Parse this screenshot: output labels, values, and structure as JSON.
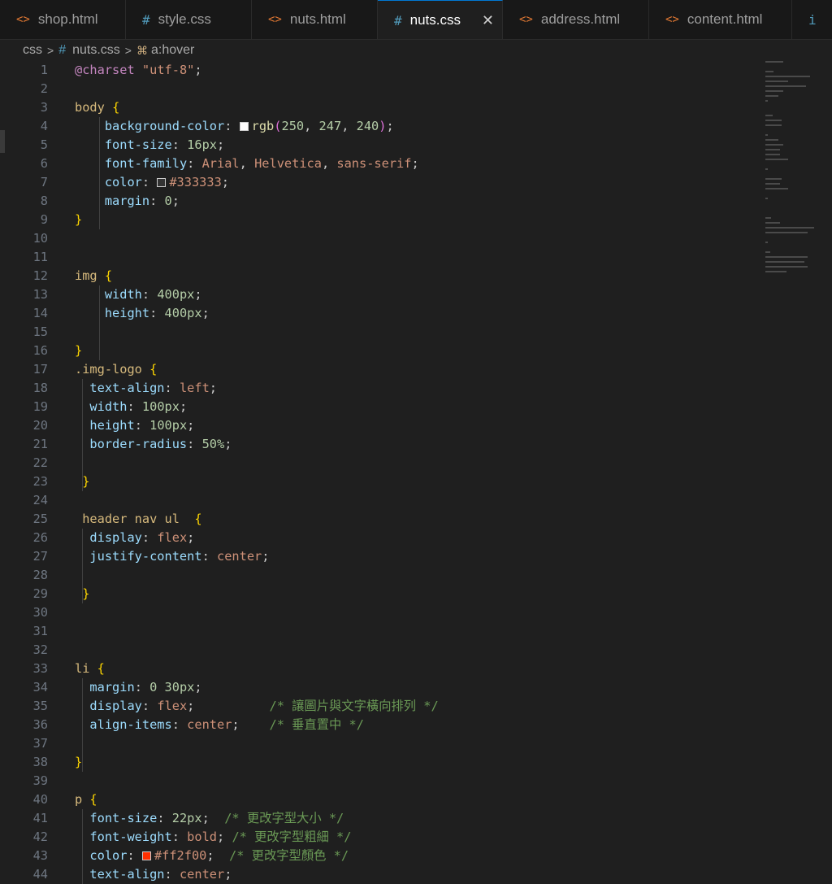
{
  "tabs": [
    {
      "label": "shop.html",
      "kind": "html",
      "icon": "html-file-icon"
    },
    {
      "label": "style.css",
      "kind": "css",
      "icon": "css-file-icon"
    },
    {
      "label": "nuts.html",
      "kind": "html",
      "icon": "html-file-icon"
    },
    {
      "label": "nuts.css",
      "kind": "css",
      "icon": "css-file-icon",
      "active": true
    },
    {
      "label": "address.html",
      "kind": "html",
      "icon": "html-file-icon"
    },
    {
      "label": "content.html",
      "kind": "html",
      "icon": "html-file-icon"
    }
  ],
  "close_glyph": "✕",
  "breadcrumb": {
    "folder": "css",
    "file": "nuts.css",
    "symbol": "a:hover"
  },
  "code_lines": [
    {
      "n": "1",
      "segs": [
        [
          "@charset",
          "at"
        ],
        [
          " ",
          ""
        ],
        [
          "\"utf-8\"",
          "str"
        ],
        [
          ";",
          "punc"
        ]
      ]
    },
    {
      "n": "2",
      "segs": []
    },
    {
      "n": "3",
      "segs": [
        [
          "body ",
          "sel"
        ],
        [
          "{",
          "brace"
        ]
      ]
    },
    {
      "n": "4",
      "segs": [
        [
          "    ",
          ""
        ],
        [
          "background-color",
          "prop"
        ],
        [
          ": ",
          "punc"
        ],
        [
          "#fffefe",
          "swatch"
        ],
        [
          "rgb",
          "fn"
        ],
        [
          "(",
          "paren"
        ],
        [
          "250",
          "num"
        ],
        [
          ", ",
          "punc"
        ],
        [
          "247",
          "num"
        ],
        [
          ", ",
          "punc"
        ],
        [
          "240",
          "num"
        ],
        [
          ")",
          "paren"
        ],
        [
          ";",
          "punc"
        ]
      ]
    },
    {
      "n": "5",
      "segs": [
        [
          "    ",
          ""
        ],
        [
          "font-size",
          "prop"
        ],
        [
          ": ",
          "punc"
        ],
        [
          "16px",
          "num"
        ],
        [
          ";",
          "punc"
        ]
      ]
    },
    {
      "n": "6",
      "segs": [
        [
          "    ",
          ""
        ],
        [
          "font-family",
          "prop"
        ],
        [
          ": ",
          "punc"
        ],
        [
          "Arial",
          "val"
        ],
        [
          ", ",
          "punc"
        ],
        [
          "Helvetica",
          "val"
        ],
        [
          ", ",
          "punc"
        ],
        [
          "sans-serif",
          "val"
        ],
        [
          ";",
          "punc"
        ]
      ]
    },
    {
      "n": "7",
      "segs": [
        [
          "    ",
          ""
        ],
        [
          "color",
          "prop"
        ],
        [
          ": ",
          "punc"
        ],
        [
          "#333333",
          "swatch"
        ],
        [
          "#333333",
          "val"
        ],
        [
          ";",
          "punc"
        ]
      ]
    },
    {
      "n": "8",
      "segs": [
        [
          "    ",
          ""
        ],
        [
          "margin",
          "prop"
        ],
        [
          ": ",
          "punc"
        ],
        [
          "0",
          "num"
        ],
        [
          ";",
          "punc"
        ]
      ]
    },
    {
      "n": "9",
      "segs": [
        [
          "}",
          "brace"
        ]
      ]
    },
    {
      "n": "10",
      "segs": []
    },
    {
      "n": "11",
      "segs": []
    },
    {
      "n": "12",
      "segs": [
        [
          "img ",
          "sel"
        ],
        [
          "{",
          "brace"
        ]
      ]
    },
    {
      "n": "13",
      "segs": [
        [
          "    ",
          ""
        ],
        [
          "width",
          "prop"
        ],
        [
          ": ",
          "punc"
        ],
        [
          "400px",
          "num"
        ],
        [
          ";",
          "punc"
        ]
      ]
    },
    {
      "n": "14",
      "segs": [
        [
          "    ",
          ""
        ],
        [
          "height",
          "prop"
        ],
        [
          ": ",
          "punc"
        ],
        [
          "400px",
          "num"
        ],
        [
          ";",
          "punc"
        ]
      ]
    },
    {
      "n": "15",
      "segs": []
    },
    {
      "n": "16",
      "segs": [
        [
          "}",
          "brace"
        ]
      ]
    },
    {
      "n": "17",
      "segs": [
        [
          ".img-logo ",
          "sel"
        ],
        [
          "{",
          "brace"
        ]
      ]
    },
    {
      "n": "18",
      "segs": [
        [
          "  ",
          ""
        ],
        [
          "text-align",
          "prop"
        ],
        [
          ": ",
          "punc"
        ],
        [
          "left",
          "val"
        ],
        [
          ";",
          "punc"
        ]
      ]
    },
    {
      "n": "19",
      "segs": [
        [
          "  ",
          ""
        ],
        [
          "width",
          "prop"
        ],
        [
          ": ",
          "punc"
        ],
        [
          "100px",
          "num"
        ],
        [
          ";",
          "punc"
        ]
      ]
    },
    {
      "n": "20",
      "segs": [
        [
          "  ",
          ""
        ],
        [
          "height",
          "prop"
        ],
        [
          ": ",
          "punc"
        ],
        [
          "100px",
          "num"
        ],
        [
          ";",
          "punc"
        ]
      ]
    },
    {
      "n": "21",
      "segs": [
        [
          "  ",
          ""
        ],
        [
          "border-radius",
          "prop"
        ],
        [
          ": ",
          "punc"
        ],
        [
          "50%",
          "num"
        ],
        [
          ";",
          "punc"
        ]
      ]
    },
    {
      "n": "22",
      "segs": []
    },
    {
      "n": "23",
      "segs": [
        [
          " ",
          ""
        ],
        [
          "}",
          "brace"
        ]
      ]
    },
    {
      "n": "24",
      "segs": []
    },
    {
      "n": "25",
      "segs": [
        [
          " ",
          ""
        ],
        [
          "header nav ul  ",
          "sel"
        ],
        [
          "{",
          "brace"
        ]
      ]
    },
    {
      "n": "26",
      "segs": [
        [
          "  ",
          ""
        ],
        [
          "display",
          "prop"
        ],
        [
          ": ",
          "punc"
        ],
        [
          "flex",
          "val"
        ],
        [
          ";",
          "punc"
        ]
      ]
    },
    {
      "n": "27",
      "segs": [
        [
          "  ",
          ""
        ],
        [
          "justify-content",
          "prop"
        ],
        [
          ": ",
          "punc"
        ],
        [
          "center",
          "val"
        ],
        [
          ";",
          "punc"
        ]
      ]
    },
    {
      "n": "28",
      "segs": []
    },
    {
      "n": "29",
      "segs": [
        [
          " ",
          ""
        ],
        [
          "}",
          "brace"
        ]
      ]
    },
    {
      "n": "30",
      "segs": []
    },
    {
      "n": "31",
      "segs": []
    },
    {
      "n": "32",
      "segs": []
    },
    {
      "n": "33",
      "segs": [
        [
          "li ",
          "sel"
        ],
        [
          "{",
          "brace"
        ]
      ]
    },
    {
      "n": "34",
      "segs": [
        [
          "  ",
          ""
        ],
        [
          "margin",
          "prop"
        ],
        [
          ": ",
          "punc"
        ],
        [
          "0 30px",
          "num"
        ],
        [
          ";",
          "punc"
        ]
      ]
    },
    {
      "n": "35",
      "segs": [
        [
          "  ",
          ""
        ],
        [
          "display",
          "prop"
        ],
        [
          ": ",
          "punc"
        ],
        [
          "flex",
          "val"
        ],
        [
          ";",
          "punc"
        ],
        [
          "          ",
          ""
        ],
        [
          "/* 讓圖片與文字橫向排列 */",
          "com"
        ]
      ]
    },
    {
      "n": "36",
      "segs": [
        [
          "  ",
          ""
        ],
        [
          "align-items",
          "prop"
        ],
        [
          ": ",
          "punc"
        ],
        [
          "center",
          "val"
        ],
        [
          ";",
          "punc"
        ],
        [
          "    ",
          ""
        ],
        [
          "/* 垂直置中 */",
          "com"
        ]
      ]
    },
    {
      "n": "37",
      "segs": []
    },
    {
      "n": "38",
      "segs": [
        [
          "}",
          "brace"
        ]
      ]
    },
    {
      "n": "39",
      "segs": []
    },
    {
      "n": "40",
      "segs": [
        [
          "p ",
          "sel"
        ],
        [
          "{",
          "brace"
        ]
      ]
    },
    {
      "n": "41",
      "segs": [
        [
          "  ",
          ""
        ],
        [
          "font-size",
          "prop"
        ],
        [
          ": ",
          "punc"
        ],
        [
          "22px",
          "num"
        ],
        [
          ";",
          "punc"
        ],
        [
          "  ",
          ""
        ],
        [
          "/* 更改字型大小 */",
          "com"
        ]
      ]
    },
    {
      "n": "42",
      "segs": [
        [
          "  ",
          ""
        ],
        [
          "font-weight",
          "prop"
        ],
        [
          ": ",
          "punc"
        ],
        [
          "bold",
          "val"
        ],
        [
          ";",
          "punc"
        ],
        [
          " ",
          ""
        ],
        [
          "/* 更改字型粗細 */",
          "com"
        ]
      ]
    },
    {
      "n": "43",
      "segs": [
        [
          "  ",
          ""
        ],
        [
          "color",
          "prop"
        ],
        [
          ": ",
          "punc"
        ],
        [
          "#ff2f00",
          "swatch"
        ],
        [
          "#ff2f00",
          "val"
        ],
        [
          ";",
          "punc"
        ],
        [
          "  ",
          ""
        ],
        [
          "/* 更改字型顏色 */",
          "com"
        ]
      ]
    },
    {
      "n": "44",
      "segs": [
        [
          "  ",
          ""
        ],
        [
          "text-align",
          "prop"
        ],
        [
          ": ",
          "punc"
        ],
        [
          "center",
          "val"
        ],
        [
          ";",
          "punc"
        ]
      ]
    }
  ]
}
